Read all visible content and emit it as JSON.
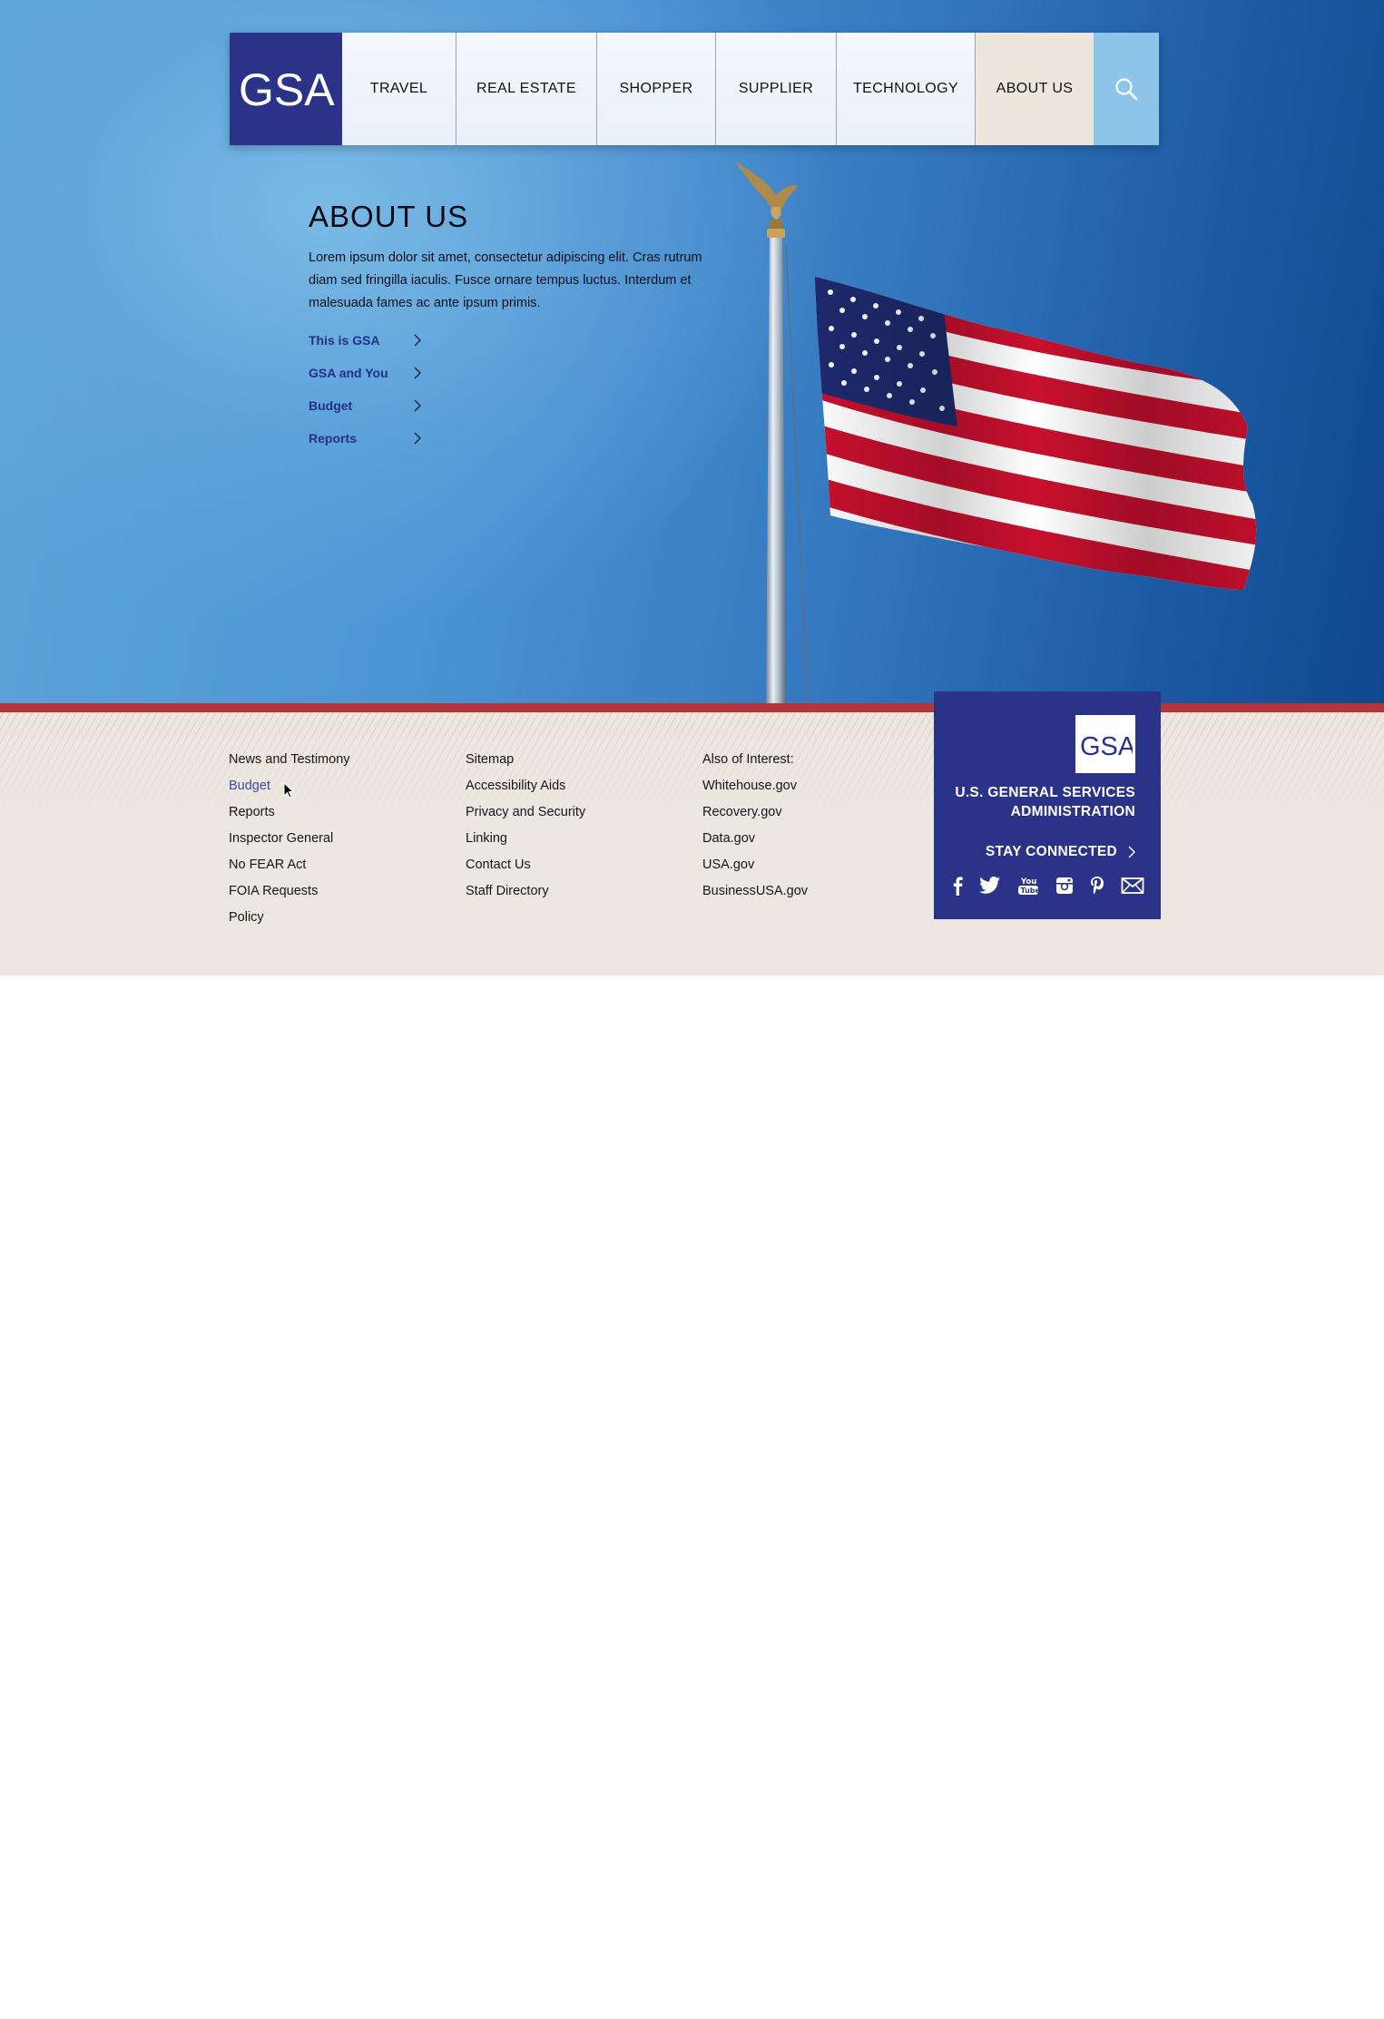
{
  "brand": {
    "logo_text": "GSA",
    "primary_color": "#2a3388",
    "accent_red": "#b5363a",
    "link_color": "#262f86"
  },
  "nav": {
    "items": [
      {
        "label": "TRAVEL"
      },
      {
        "label": "REAL ESTATE"
      },
      {
        "label": "SHOPPER"
      },
      {
        "label": "SUPPLIER"
      },
      {
        "label": "TECHNOLOGY"
      },
      {
        "label": "ABOUT US",
        "active": true
      }
    ],
    "search_icon": "search-icon"
  },
  "hero": {
    "title": "ABOUT US",
    "body": "Lorem ipsum dolor sit amet, consectetur adipiscing elit. Cras rutrum diam sed fringilla iaculis. Fusce ornare tempus luctus. Interdum et malesuada fames ac ante ipsum primis.",
    "links": [
      {
        "label": "This is GSA"
      },
      {
        "label": "GSA and You"
      },
      {
        "label": "Budget"
      },
      {
        "label": "Reports"
      }
    ],
    "image": "american-flag-on-pole-with-eagle"
  },
  "footer": {
    "col1": [
      "News and Testimony",
      "Budget",
      "Reports",
      "Inspector General",
      "No FEAR Act",
      "FOIA Requests",
      "Policy"
    ],
    "col2": [
      "Sitemap",
      "Accessibility Aids",
      "Privacy and Security",
      "Linking",
      "Contact Us",
      "Staff Directory"
    ],
    "col3_heading": "Also of Interest:",
    "col3": [
      "Whitehouse.gov",
      "Recovery.gov",
      "Data.gov",
      "USA.gov",
      "BusinessUSA.gov"
    ],
    "hovered_link": "Budget"
  },
  "gsa_box": {
    "logo_text": "GSA",
    "name_line1": "U.S. GENERAL SERVICES",
    "name_line2": "ADMINISTRATION",
    "stay_connected": "STAY CONNECTED",
    "social_icons": [
      "facebook-icon",
      "twitter-icon",
      "youtube-icon",
      "instagram-icon",
      "pinterest-icon",
      "email-icon"
    ]
  }
}
